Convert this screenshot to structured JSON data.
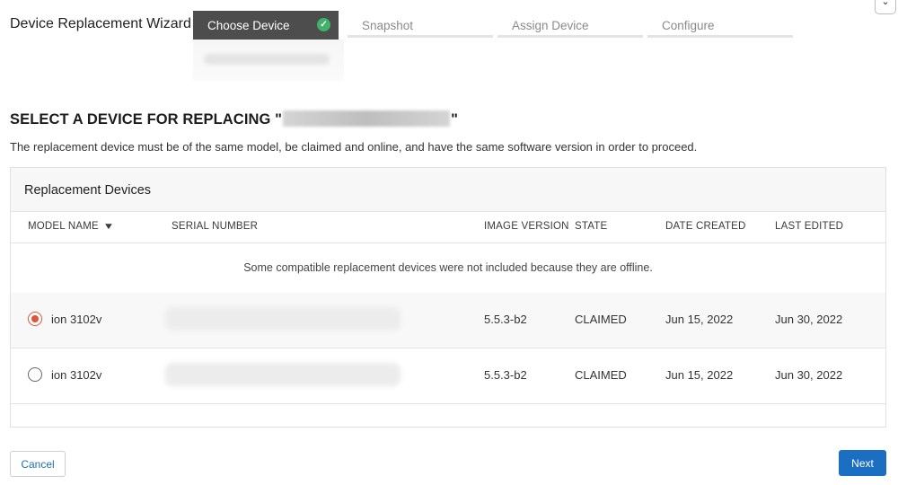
{
  "wizard": {
    "title": "Device Replacement Wizard",
    "steps": [
      {
        "label": "Choose Device",
        "state": "active-complete"
      },
      {
        "label": "Snapshot",
        "state": "pending"
      },
      {
        "label": "Assign Device",
        "state": "pending"
      },
      {
        "label": "Configure",
        "state": "pending"
      }
    ]
  },
  "main": {
    "heading_prefix": "SELECT A DEVICE FOR REPLACING \"",
    "heading_suffix": "\"",
    "subtext": "The replacement device must be of the same model, be claimed and online, and have the same software version in order to proceed."
  },
  "panel": {
    "title": "Replacement Devices",
    "columns": [
      "MODEL NAME",
      "SERIAL NUMBER",
      "IMAGE VERSION",
      "STATE",
      "DATE CREATED",
      "LAST EDITED"
    ],
    "notice": "Some compatible replacement devices were not included because they are offline.",
    "rows": [
      {
        "selected": true,
        "model": "ion 3102v",
        "image_version": "5.5.3-b2",
        "state": "CLAIMED",
        "date_created": "Jun 15, 2022",
        "last_edited": "Jun 30, 2022"
      },
      {
        "selected": false,
        "model": "ion 3102v",
        "image_version": "5.5.3-b2",
        "state": "CLAIMED",
        "date_created": "Jun 15, 2022",
        "last_edited": "Jun 30, 2022"
      }
    ]
  },
  "footer": {
    "cancel_label": "Cancel",
    "next_label": "Next"
  },
  "colors": {
    "accent_blue": "#1b6fc2",
    "radio_selected": "#e2553a",
    "step_active_bg": "#4d4d4d",
    "check_green": "#3fb36b"
  },
  "icons": [
    "check-circle-icon",
    "chevron-down-icon",
    "radio-selected-icon",
    "radio-unselected-icon"
  ]
}
